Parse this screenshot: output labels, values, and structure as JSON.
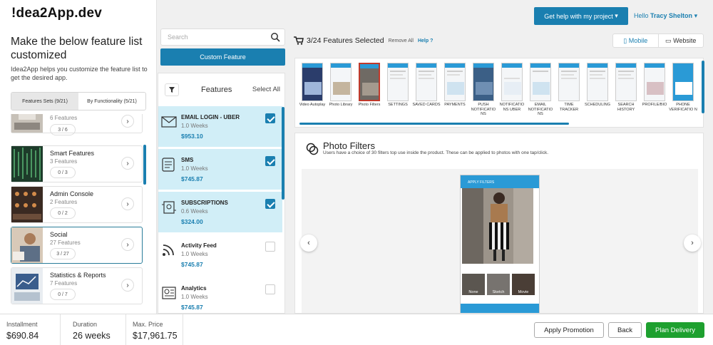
{
  "brand": {
    "logo_pre": "!dea2",
    "logo_app": "App",
    "logo_post": ".dev"
  },
  "left": {
    "heading": "Make the below feature list customized",
    "description": "Idea2App helps you customize the feature list to get the desired app.",
    "tabs": [
      "Features Sets (9/21)",
      "By Functionality (5/21)"
    ],
    "categories": [
      {
        "name": "",
        "count": "6 Features",
        "pill": "3 / 6"
      },
      {
        "name": "Smart Features",
        "count": "3 Features",
        "pill": "0 / 3"
      },
      {
        "name": "Admin Console",
        "count": "2 Features",
        "pill": "0 / 2"
      },
      {
        "name": "Social",
        "count": "27 Features",
        "pill": "3 / 27"
      },
      {
        "name": "Statistics & Reports",
        "count": "7 Features",
        "pill": "0 / 7"
      }
    ]
  },
  "middle": {
    "search_placeholder": "Search",
    "custom_button": "Custom Feature",
    "features_title": "Features",
    "select_all": "Select All",
    "features": [
      {
        "name": "EMAIL LOGIN - UBER",
        "weeks": "1.0 Weeks",
        "price": "$953.10",
        "checked": true,
        "icon": "email-icon"
      },
      {
        "name": "SMS",
        "weeks": "1.0 Weeks",
        "price": "$745.87",
        "checked": true,
        "icon": "sms-icon"
      },
      {
        "name": "SUBSCRIPTIONS",
        "weeks": "0.6 Weeks",
        "price": "$324.00",
        "checked": true,
        "icon": "subscriptions-icon"
      },
      {
        "name": "Activity Feed",
        "weeks": "1.0 Weeks",
        "price": "$745.87",
        "checked": false,
        "icon": "activity-feed-icon"
      },
      {
        "name": "Analytics",
        "weeks": "1.0 Weeks",
        "price": "$745.87",
        "checked": false,
        "icon": "analytics-icon"
      }
    ]
  },
  "header": {
    "help_button": "Get help with my project",
    "hello_prefix": "Hello",
    "user_name": "Tracy  Shelton"
  },
  "selection": {
    "summary": "3/24 Features Selected",
    "remove_all": "Remove All",
    "help": "Help",
    "views": [
      "Mobile",
      "Website"
    ]
  },
  "carousel": [
    "Video Autoplay",
    "Photo Library",
    "Photo Filters",
    "SETTINGS",
    "SAVED CARDS",
    "PAYMENTS",
    "PUSH NOTIFICATIO NS",
    "NOTIFICATIO NS UBER",
    "EMAIL NOTIFICATIO NS",
    "TIME TRACKER",
    "SCHEDULING",
    "SEARCH HISTORY",
    "PROFILE/BIO",
    "PHONE VERIFICATIO N"
  ],
  "detail": {
    "title": "Photo Filters",
    "description": "Users have a choice of 30 filters top use inside the product. These can be applied to photos with one tap/click.",
    "mock_header": "APPLY FILTERS",
    "filters": [
      "None",
      "Sketch",
      "Movie"
    ]
  },
  "bottom": {
    "installment_label": "Installment",
    "installment_value": "$690.84",
    "duration_label": "Duration",
    "duration_value": "26 weeks",
    "max_price_label": "Max. Price",
    "max_price_value": "$17,961.75",
    "apply_promotion": "Apply Promotion",
    "back": "Back",
    "plan_delivery": "Plan Delivery"
  },
  "colors": {
    "primary": "#1a7fb0",
    "selected_bg": "#d1eef7",
    "green": "#1ea02f"
  }
}
